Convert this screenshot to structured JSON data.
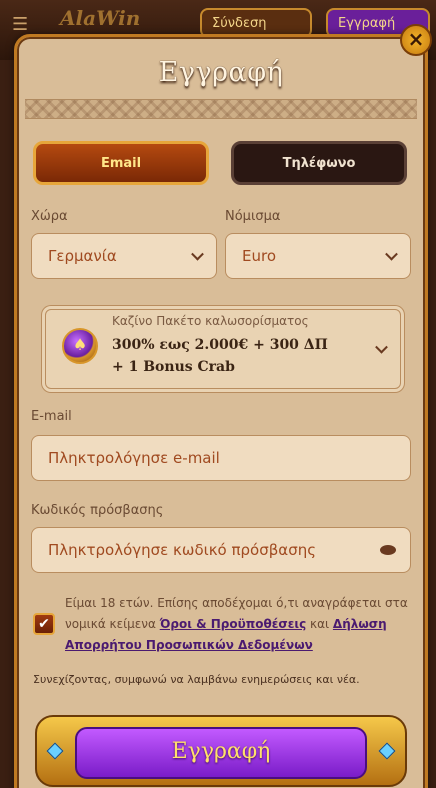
{
  "background": {
    "logo": "AlaWin",
    "login_label": "Σύνδεση",
    "register_label": "Εγγραφή"
  },
  "modal": {
    "title": "Εγγραφή",
    "close_symbol": "×"
  },
  "tabs": [
    {
      "label": "Email",
      "active": true
    },
    {
      "label": "Τηλέφωνο",
      "active": false
    }
  ],
  "country": {
    "label": "Χώρα",
    "value": "Γερμανία"
  },
  "currency": {
    "label": "Νόμισμα",
    "value": "Euro"
  },
  "bonus": {
    "subtitle": "Καζίνο Πακέτο καλωσορίσματος",
    "line1": "300% εως 2.000€ + 300 ΔΠ",
    "line2": "+ 1 Bonus Crab"
  },
  "email": {
    "label": "E-mail",
    "placeholder": "Πληκτρολόγησε e-mail"
  },
  "password": {
    "label": "Κωδικός πρόσβασης",
    "placeholder": "Πληκτρολόγησε κωδικό πρόσβασης"
  },
  "terms": {
    "text_before": "Είμαι 18 ετών. Επίσης αποδέχομαι ό,τι αναγράφεται στα νομικά κείμενα",
    "link1": "Όροι & Προϋποθέσεις",
    "and": "και",
    "link2": "Δήλωση Απορρήτου Προσωπικών Δεδομένων",
    "checked": true
  },
  "consent_text": "Συνεχίζοντας, συμφωνώ να λαμβάνω ενημερώσεις και νέα.",
  "submit_label": "Εγγραφή",
  "colors": {
    "accent_gold": "#e7a63a",
    "submit_purple": "#9a3de0",
    "panel": "#d9bd98"
  }
}
